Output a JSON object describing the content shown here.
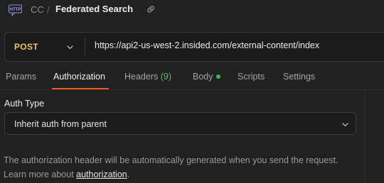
{
  "header": {
    "http_badge": "HTTP",
    "collection": "CC",
    "separator": "/",
    "title": "Federated Search",
    "icons": [
      "http-request-icon",
      "link-icon"
    ]
  },
  "request": {
    "method": "POST",
    "url": "https://api2-us-west-2.insided.com/external-content/index"
  },
  "tabs": [
    {
      "label": "Params"
    },
    {
      "label": "Authorization",
      "active": true
    },
    {
      "label": "Headers",
      "count": "(9)"
    },
    {
      "label": "Body",
      "indicator": "green-dot"
    },
    {
      "label": "Scripts"
    },
    {
      "label": "Settings"
    }
  ],
  "auth": {
    "type_label": "Auth Type",
    "selected": "Inherit auth from parent",
    "description_line1": "The authorization header will be automatically generated when you send the request.",
    "description_line2_prefix": "Learn more about ",
    "description_link": "authorization",
    "description_line2_suffix": "."
  },
  "colors": {
    "background": "#212121",
    "method_post": "#e8c56a",
    "active_tab_underline": "#ef5b25",
    "headers_count": "#5cbf6a",
    "body_dot": "#3fb55a"
  }
}
